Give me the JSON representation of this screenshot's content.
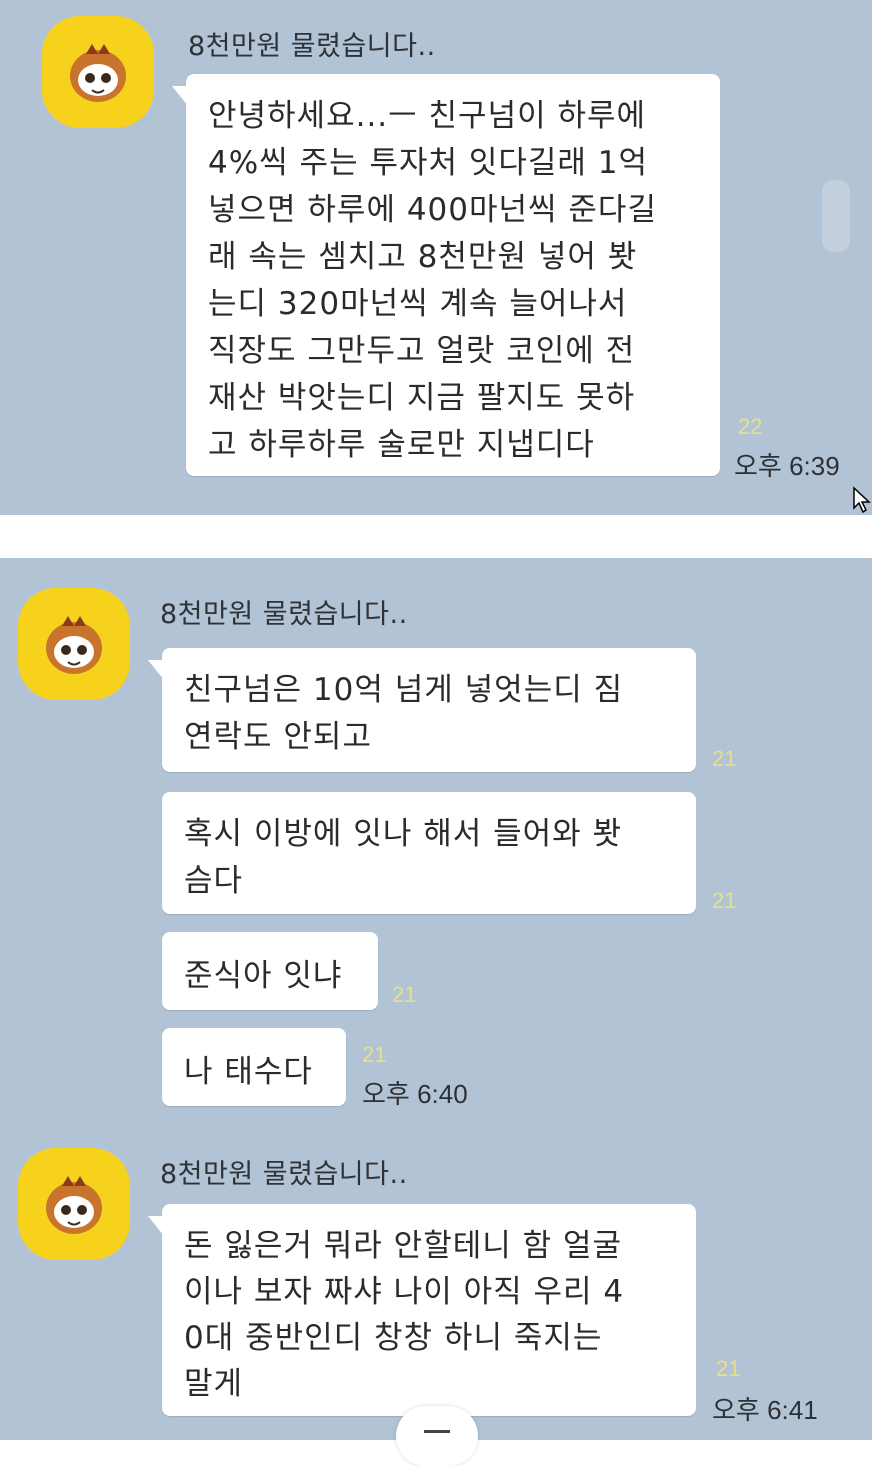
{
  "colors": {
    "chat_background": "#b3c3d6",
    "bubble": "#ffffff",
    "avatar": "#f7d21c",
    "unread_count": "#e6e08a"
  },
  "panel1": {
    "sender": "8천만원 물렸습니다..",
    "message": {
      "lines": [
        "안녕하세요...ㅡ 친구넘이 하루에",
        "4%씩 주는 투자처 잇다길래 1억",
        "넣으면 하루에 400마넌씩 준다길",
        "래 속는 셈치고 8천만원 넣어 봣",
        "는디 320마넌씩 계속 늘어나서",
        "직장도 그만두고 얼랏 코인에 전",
        "재산 박앗는디 지금 팔지도 못하",
        "고 하루하루 술로만 지냅디다"
      ],
      "count": "22",
      "time": "오후 6:39"
    }
  },
  "panel2": {
    "group1": {
      "sender": "8천만원 물렸습니다..",
      "messages": [
        {
          "lines": [
            "친구넘은 10억 넘게 넣엇는디 짐",
            "연락도 안되고"
          ],
          "count": "21"
        },
        {
          "lines": [
            "혹시 이방에 잇나 해서 들어와 봣",
            "슴다"
          ],
          "count": "21"
        },
        {
          "lines": [
            "준식아 잇냐"
          ],
          "count": "21"
        },
        {
          "lines": [
            "나 태수다"
          ],
          "count": "21",
          "time": "오후 6:40"
        }
      ]
    },
    "group2": {
      "sender": "8천만원 물렸습니다..",
      "message": {
        "lines": [
          "돈 잃은거 뭐라 안할테니 함 얼굴",
          "이나 보자 짜샤 나이 아직 우리 4",
          "0대 중반인디 창창 하니 죽지는",
          "말게"
        ],
        "count": "21",
        "time": "오후 6:41"
      }
    }
  }
}
